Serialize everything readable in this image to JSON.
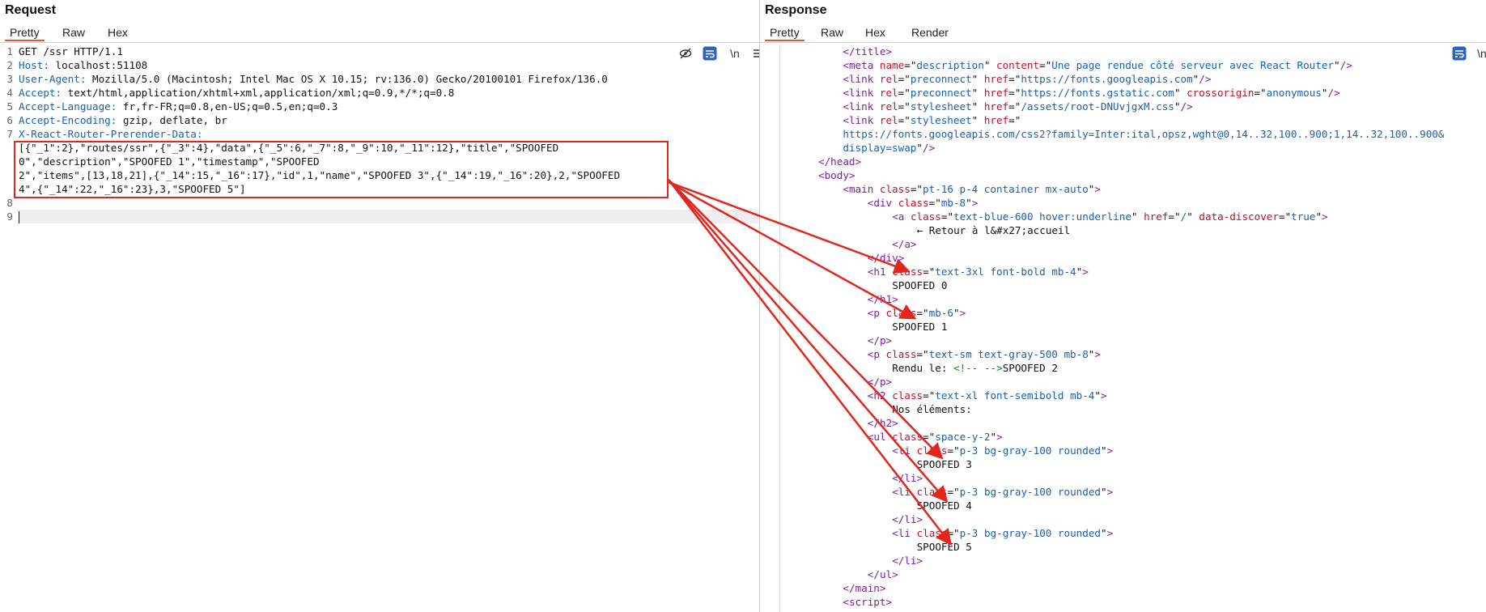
{
  "request": {
    "title": "Request",
    "tabs": [
      "Pretty",
      "Raw",
      "Hex"
    ],
    "tool_newline": "\\n",
    "lines": [
      {
        "num": "1",
        "name": "",
        "value": "GET /ssr HTTP/1.1"
      },
      {
        "num": "2",
        "name": "Host:",
        "value": " localhost:51108"
      },
      {
        "num": "3",
        "name": "User-Agent:",
        "value": " Mozilla/5.0 (Macintosh; Intel Mac OS X 10.15; rv:136.0) Gecko/20100101 Firefox/136.0"
      },
      {
        "num": "4",
        "name": "Accept:",
        "value": " text/html,application/xhtml+xml,application/xml;q=0.9,*/*;q=0.8"
      },
      {
        "num": "5",
        "name": "Accept-Language:",
        "value": " fr,fr-FR;q=0.8,en-US;q=0.5,en;q=0.3"
      },
      {
        "num": "6",
        "name": "Accept-Encoding:",
        "value": " gzip, deflate, br"
      },
      {
        "num": "7",
        "name": "X-React-Router-Prerender-Data:",
        "value": ""
      },
      {
        "num": "",
        "name": "",
        "value": "[{\"_1\":2},\"routes/ssr\",{\"_3\":4},\"data\",{\"_5\":6,\"_7\":8,\"_9\":10,\"_11\":12},\"title\",\"SPOOFED"
      },
      {
        "num": "",
        "name": "",
        "value": "0\",\"description\",\"SPOOFED 1\",\"timestamp\",\"SPOOFED"
      },
      {
        "num": "",
        "name": "",
        "value": "2\",\"items\",[13,18,21],{\"_14\":15,\"_16\":17},\"id\",1,\"name\",\"SPOOFED 3\",{\"_14\":19,\"_16\":20},2,\"SPOOFED"
      },
      {
        "num": "",
        "name": "",
        "value": "4\",{\"_14\":22,\"_16\":23},3,\"SPOOFED 5\"]"
      },
      {
        "num": "8",
        "name": "",
        "value": ""
      },
      {
        "num": "9",
        "name": "",
        "value": ""
      }
    ]
  },
  "response": {
    "title": "Response",
    "tabs": [
      "Pretty",
      "Raw",
      "Hex",
      "Render"
    ],
    "tool_newline": "\\n",
    "lines": [
      [
        {
          "c": "tag",
          "t": "</title>"
        }
      ],
      [
        {
          "c": "tag",
          "t": "<meta "
        },
        {
          "c": "attr",
          "t": "name"
        },
        {
          "c": "txt",
          "t": "=\""
        },
        {
          "c": "aval",
          "t": "description"
        },
        {
          "c": "txt",
          "t": "\" "
        },
        {
          "c": "attr",
          "t": "content"
        },
        {
          "c": "txt",
          "t": "=\""
        },
        {
          "c": "aval",
          "t": "Une page rendue côté serveur avec React Router"
        },
        {
          "c": "txt",
          "t": "\""
        },
        {
          "c": "tag",
          "t": "/>"
        }
      ],
      [
        {
          "c": "tag",
          "t": "<link "
        },
        {
          "c": "attr",
          "t": "rel"
        },
        {
          "c": "txt",
          "t": "=\""
        },
        {
          "c": "aval",
          "t": "preconnect"
        },
        {
          "c": "txt",
          "t": "\" "
        },
        {
          "c": "attr",
          "t": "href"
        },
        {
          "c": "txt",
          "t": "=\""
        },
        {
          "c": "aval",
          "t": "https://fonts.googleapis.com"
        },
        {
          "c": "txt",
          "t": "\""
        },
        {
          "c": "tag",
          "t": "/>"
        }
      ],
      [
        {
          "c": "tag",
          "t": "<link "
        },
        {
          "c": "attr",
          "t": "rel"
        },
        {
          "c": "txt",
          "t": "=\""
        },
        {
          "c": "aval",
          "t": "preconnect"
        },
        {
          "c": "txt",
          "t": "\" "
        },
        {
          "c": "attr",
          "t": "href"
        },
        {
          "c": "txt",
          "t": "=\""
        },
        {
          "c": "aval",
          "t": "https://fonts.gstatic.com"
        },
        {
          "c": "txt",
          "t": "\" "
        },
        {
          "c": "attr",
          "t": "crossorigin"
        },
        {
          "c": "txt",
          "t": "=\""
        },
        {
          "c": "aval",
          "t": "anonymous"
        },
        {
          "c": "txt",
          "t": "\""
        },
        {
          "c": "tag",
          "t": "/>"
        }
      ],
      [
        {
          "c": "tag",
          "t": "<link "
        },
        {
          "c": "attr",
          "t": "rel"
        },
        {
          "c": "txt",
          "t": "=\""
        },
        {
          "c": "aval",
          "t": "stylesheet"
        },
        {
          "c": "txt",
          "t": "\" "
        },
        {
          "c": "attr",
          "t": "href"
        },
        {
          "c": "txt",
          "t": "=\""
        },
        {
          "c": "aval",
          "t": "/assets/root-DNUvjgxM.css"
        },
        {
          "c": "txt",
          "t": "\""
        },
        {
          "c": "tag",
          "t": "/>"
        }
      ],
      [
        {
          "c": "tag",
          "t": "<link "
        },
        {
          "c": "attr",
          "t": "rel"
        },
        {
          "c": "txt",
          "t": "=\""
        },
        {
          "c": "aval",
          "t": "stylesheet"
        },
        {
          "c": "txt",
          "t": "\" "
        },
        {
          "c": "attr",
          "t": "href"
        },
        {
          "c": "txt",
          "t": "=\""
        }
      ],
      [
        {
          "c": "aval",
          "t": "https://fonts.googleapis.com/css2?family=Inter:ital,opsz,wght@0,14..32,100..900;1,14..32,100..900&"
        }
      ],
      [
        {
          "c": "aval",
          "t": "display=swap"
        },
        {
          "c": "txt",
          "t": "\""
        },
        {
          "c": "tag",
          "t": "/>"
        }
      ],
      [
        {
          "c": "tag",
          "t": "</head>"
        }
      ],
      [
        {
          "c": "tag",
          "t": "<body>"
        }
      ],
      [
        {
          "c": "tag",
          "t": "<main "
        },
        {
          "c": "attr",
          "t": "class"
        },
        {
          "c": "txt",
          "t": "=\""
        },
        {
          "c": "aval",
          "t": "pt-16 p-4 container mx-auto"
        },
        {
          "c": "txt",
          "t": "\""
        },
        {
          "c": "tag",
          "t": ">"
        }
      ],
      [
        {
          "c": "tag",
          "t": "<div "
        },
        {
          "c": "attr",
          "t": "class"
        },
        {
          "c": "txt",
          "t": "=\""
        },
        {
          "c": "aval",
          "t": "mb-8"
        },
        {
          "c": "txt",
          "t": "\""
        },
        {
          "c": "tag",
          "t": ">"
        }
      ],
      [
        {
          "c": "tag",
          "t": "<a "
        },
        {
          "c": "attr",
          "t": "class"
        },
        {
          "c": "txt",
          "t": "=\""
        },
        {
          "c": "aval",
          "t": "text-blue-600 hover:underline"
        },
        {
          "c": "txt",
          "t": "\" "
        },
        {
          "c": "attr",
          "t": "href"
        },
        {
          "c": "txt",
          "t": "=\""
        },
        {
          "c": "aval",
          "t": "/"
        },
        {
          "c": "txt",
          "t": "\" "
        },
        {
          "c": "attr",
          "t": "data-discover"
        },
        {
          "c": "txt",
          "t": "=\""
        },
        {
          "c": "aval",
          "t": "true"
        },
        {
          "c": "txt",
          "t": "\""
        },
        {
          "c": "tag",
          "t": ">"
        }
      ],
      [
        {
          "c": "txt",
          "t": "← Retour à l&#x27;accueil"
        }
      ],
      [
        {
          "c": "tag",
          "t": "</a>"
        }
      ],
      [
        {
          "c": "tag",
          "t": "</div>"
        }
      ],
      [
        {
          "c": "tag",
          "t": "<h1 "
        },
        {
          "c": "attr",
          "t": "class"
        },
        {
          "c": "txt",
          "t": "=\""
        },
        {
          "c": "aval",
          "t": "text-3xl font-bold mb-4"
        },
        {
          "c": "txt",
          "t": "\""
        },
        {
          "c": "tag",
          "t": ">"
        }
      ],
      [
        {
          "c": "txt",
          "t": "SPOOFED 0"
        }
      ],
      [
        {
          "c": "tag",
          "t": "</h1>"
        }
      ],
      [
        {
          "c": "tag",
          "t": "<p "
        },
        {
          "c": "attr",
          "t": "class"
        },
        {
          "c": "txt",
          "t": "=\""
        },
        {
          "c": "aval",
          "t": "mb-6"
        },
        {
          "c": "txt",
          "t": "\""
        },
        {
          "c": "tag",
          "t": ">"
        }
      ],
      [
        {
          "c": "txt",
          "t": "SPOOFED 1"
        }
      ],
      [
        {
          "c": "tag",
          "t": "</p>"
        }
      ],
      [
        {
          "c": "tag",
          "t": "<p "
        },
        {
          "c": "attr",
          "t": "class"
        },
        {
          "c": "txt",
          "t": "=\""
        },
        {
          "c": "aval",
          "t": "text-sm text-gray-500 mb-8"
        },
        {
          "c": "txt",
          "t": "\""
        },
        {
          "c": "tag",
          "t": ">"
        }
      ],
      [
        {
          "c": "txt",
          "t": "Rendu le: "
        },
        {
          "c": "comment",
          "t": "<!-- -->"
        },
        {
          "c": "txt",
          "t": "SPOOFED 2"
        }
      ],
      [
        {
          "c": "tag",
          "t": "</p>"
        }
      ],
      [
        {
          "c": "tag",
          "t": "<h2 "
        },
        {
          "c": "attr",
          "t": "class"
        },
        {
          "c": "txt",
          "t": "=\""
        },
        {
          "c": "aval",
          "t": "text-xl font-semibold mb-4"
        },
        {
          "c": "txt",
          "t": "\""
        },
        {
          "c": "tag",
          "t": ">"
        }
      ],
      [
        {
          "c": "txt",
          "t": "Nos éléments:"
        }
      ],
      [
        {
          "c": "tag",
          "t": "</h2>"
        }
      ],
      [
        {
          "c": "tag",
          "t": "<ul "
        },
        {
          "c": "attr",
          "t": "class"
        },
        {
          "c": "txt",
          "t": "=\""
        },
        {
          "c": "aval",
          "t": "space-y-2"
        },
        {
          "c": "txt",
          "t": "\""
        },
        {
          "c": "tag",
          "t": ">"
        }
      ],
      [
        {
          "c": "tag",
          "t": "<li "
        },
        {
          "c": "attr",
          "t": "class"
        },
        {
          "c": "txt",
          "t": "=\""
        },
        {
          "c": "aval",
          "t": "p-3 bg-gray-100 rounded"
        },
        {
          "c": "txt",
          "t": "\""
        },
        {
          "c": "tag",
          "t": ">"
        }
      ],
      [
        {
          "c": "txt",
          "t": "SPOOFED 3"
        }
      ],
      [
        {
          "c": "tag",
          "t": "</li>"
        }
      ],
      [
        {
          "c": "tag",
          "t": "<li "
        },
        {
          "c": "attr",
          "t": "class"
        },
        {
          "c": "txt",
          "t": "=\""
        },
        {
          "c": "aval",
          "t": "p-3 bg-gray-100 rounded"
        },
        {
          "c": "txt",
          "t": "\""
        },
        {
          "c": "tag",
          "t": ">"
        }
      ],
      [
        {
          "c": "txt",
          "t": "SPOOFED 4"
        }
      ],
      [
        {
          "c": "tag",
          "t": "</li>"
        }
      ],
      [
        {
          "c": "tag",
          "t": "<li "
        },
        {
          "c": "attr",
          "t": "class"
        },
        {
          "c": "txt",
          "t": "=\""
        },
        {
          "c": "aval",
          "t": "p-3 bg-gray-100 rounded"
        },
        {
          "c": "txt",
          "t": "\""
        },
        {
          "c": "tag",
          "t": ">"
        }
      ],
      [
        {
          "c": "txt",
          "t": "SPOOFED 5"
        }
      ],
      [
        {
          "c": "tag",
          "t": "</li>"
        }
      ],
      [
        {
          "c": "tag",
          "t": "</ul>"
        }
      ],
      [
        {
          "c": "tag",
          "t": "</main>"
        }
      ],
      [
        {
          "c": "tag",
          "t": "<script>"
        }
      ]
    ]
  },
  "annotation": {
    "box_color": "#e4251b",
    "arrow_color": "#e4251b"
  }
}
